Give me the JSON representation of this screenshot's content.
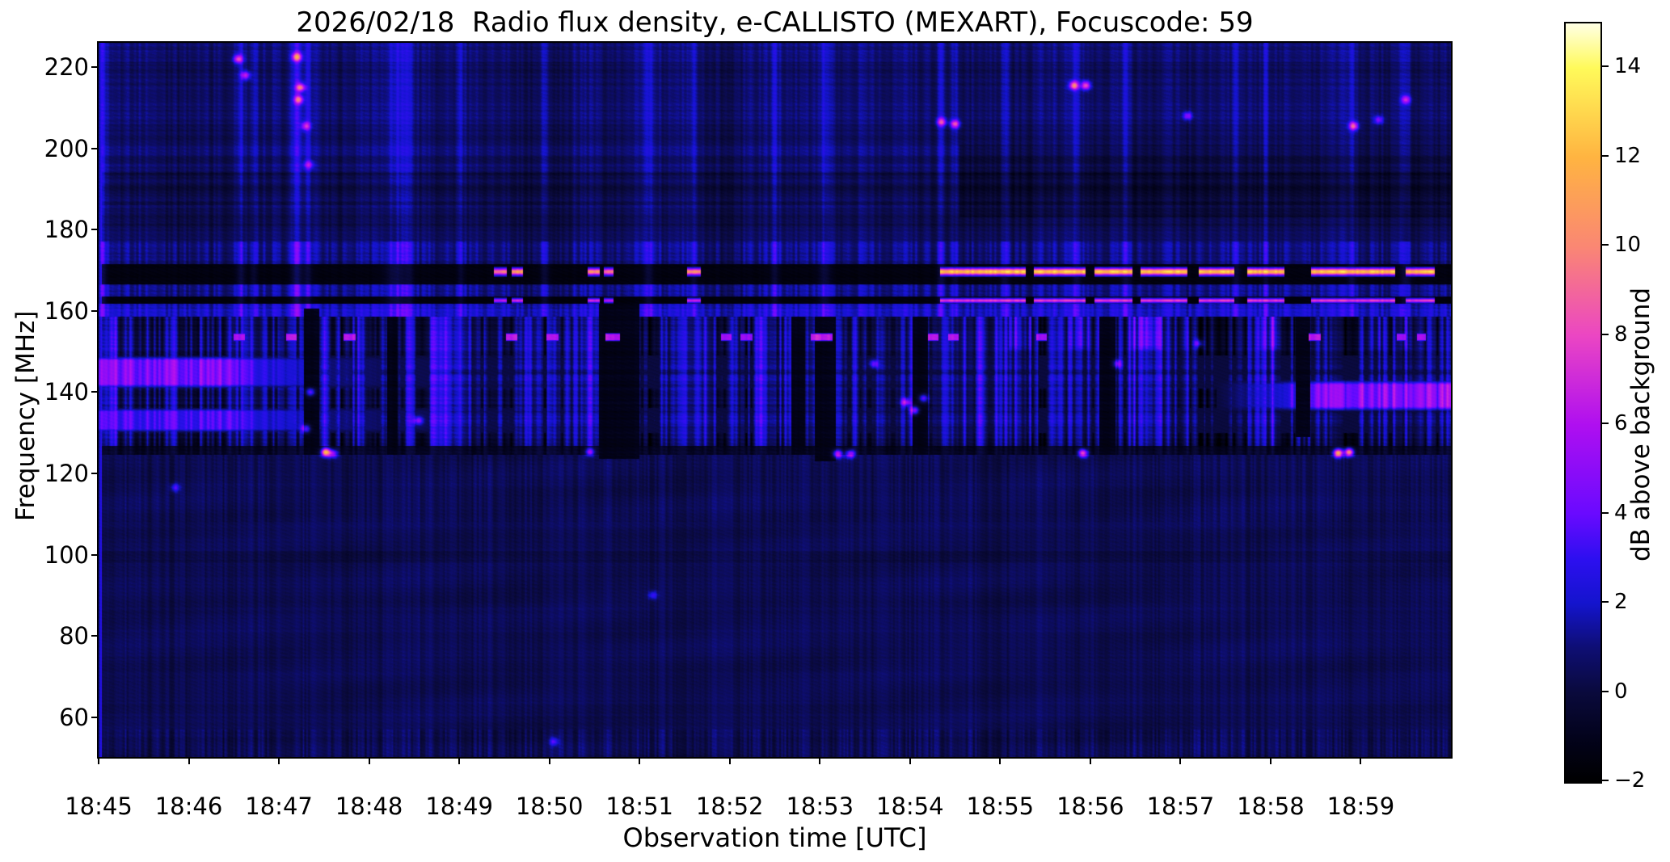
{
  "chart_data": {
    "type": "heatmap",
    "subtype": "radio-spectrogram",
    "title": "2026/02/18  Radio flux density, e-CALLISTO (MEXART), Focuscode: 59",
    "xlabel": "Observation time [UTC]",
    "ylabel": "Frequency [MHz]",
    "colorbar_label": "dB above background",
    "x_tick_labels": [
      "18:45",
      "18:46",
      "18:47",
      "18:48",
      "18:49",
      "18:50",
      "18:51",
      "18:52",
      "18:53",
      "18:54",
      "18:55",
      "18:56",
      "18:57",
      "18:58",
      "18:59"
    ],
    "x_tick_minutes": [
      0,
      1,
      2,
      3,
      4,
      5,
      6,
      7,
      8,
      9,
      10,
      11,
      12,
      13,
      14
    ],
    "time_range_minutes": [
      0,
      15
    ],
    "time_start_label": "18:45",
    "y_tick_values": [
      220,
      200,
      180,
      160,
      140,
      120,
      100,
      80,
      60
    ],
    "freq_range_mhz": [
      50.2,
      226
    ],
    "colorbar_tick_values": [
      -2,
      0,
      2,
      4,
      6,
      8,
      10,
      12,
      14
    ],
    "colorbar_tick_labels": [
      "−2",
      "0",
      "2",
      "4",
      "6",
      "8",
      "10",
      "12",
      "14"
    ],
    "value_range_db": [
      -2,
      15
    ],
    "colormap_stops": [
      {
        "v": -2,
        "c": [
          0,
          0,
          0
        ]
      },
      {
        "v": -1,
        "c": [
          3,
          3,
          28
        ]
      },
      {
        "v": 0,
        "c": [
          10,
          10,
          60
        ]
      },
      {
        "v": 1,
        "c": [
          14,
          14,
          115
        ]
      },
      {
        "v": 2,
        "c": [
          20,
          20,
          205
        ]
      },
      {
        "v": 3,
        "c": [
          45,
          15,
          240
        ]
      },
      {
        "v": 4,
        "c": [
          105,
          10,
          255
        ]
      },
      {
        "v": 6,
        "c": [
          175,
          15,
          240
        ]
      },
      {
        "v": 8,
        "c": [
          235,
          70,
          195
        ]
      },
      {
        "v": 10,
        "c": [
          250,
          135,
          115
        ]
      },
      {
        "v": 12,
        "c": [
          255,
          180,
          65
        ]
      },
      {
        "v": 14,
        "c": [
          255,
          250,
          90
        ]
      },
      {
        "v": 15,
        "c": [
          255,
          255,
          228
        ]
      }
    ],
    "spectral_regions": [
      {
        "name": "low-quiet",
        "f": [
          50.2,
          124.5
        ],
        "base_db": 0.42,
        "stripe_db": 0.42,
        "note": "uniform dark blue, fine vertical striping, stronger stripes below 57 MHz"
      },
      {
        "name": "active-mixed",
        "f": [
          124.5,
          158.5
        ],
        "base_db": 1.05,
        "stripe_db": 2.1,
        "note": "alternating blue and black vertical columns"
      },
      {
        "name": "bright-noise",
        "f": [
          158.5,
          161.8
        ],
        "base_db": 2.0,
        "stripe_db": 0.9
      },
      {
        "name": "black-line-162",
        "f": [
          161.8,
          163.5
        ],
        "base_db": -1.45
      },
      {
        "name": "noise-164",
        "f": [
          163.5,
          166.5
        ],
        "base_db": 1.3,
        "stripe_db": 0.9
      },
      {
        "name": "black-band-169",
        "f": [
          166.5,
          171.5
        ],
        "base_db": -1.5
      },
      {
        "name": "noise-174",
        "f": [
          171.5,
          177
        ],
        "base_db": 1.0,
        "stripe_db": 0.9
      },
      {
        "name": "high-band",
        "f": [
          177,
          226
        ],
        "base_db": 0.72,
        "stripe_db": 0.55,
        "dark_rows": [
          [
            186,
            194,
            -0.5
          ],
          [
            180.5,
            184,
            -0.35
          ],
          [
            202,
            204.5,
            -0.2
          ]
        ],
        "right_dark_swath": {
          "t_after": 9.55,
          "f": [
            183,
            201
          ],
          "db": -0.55
        }
      }
    ],
    "channel_lines": [
      {
        "name": "bright-carrier-170MHz",
        "f_center": 169.65,
        "f_width": 1.5,
        "peak_db": 13.8,
        "segments": [
          [
            4.38,
            4.53,
            10.5
          ],
          [
            4.58,
            4.71,
            12.5
          ],
          [
            5.42,
            5.56,
            11
          ],
          [
            5.6,
            5.71,
            10.5
          ],
          [
            6.53,
            6.68,
            11.5
          ],
          [
            9.33,
            15,
            13.8
          ]
        ],
        "gaps": [
          [
            10.28,
            10.37
          ],
          [
            10.95,
            11.05
          ],
          [
            11.47,
            11.56
          ],
          [
            12.08,
            12.2
          ],
          [
            12.6,
            12.74
          ],
          [
            13.15,
            13.45
          ],
          [
            14.38,
            14.5
          ],
          [
            14.82,
            15
          ]
        ]
      },
      {
        "name": "carrier-162.5MHz",
        "f_center": 162.55,
        "f_width": 0.95,
        "peak_db": 8.6,
        "segments": [
          [
            4.38,
            4.53,
            7
          ],
          [
            4.58,
            4.71,
            8
          ],
          [
            5.42,
            5.56,
            7.5
          ],
          [
            5.6,
            5.71,
            7
          ],
          [
            6.53,
            6.68,
            7.5
          ],
          [
            9.33,
            15,
            8.6
          ]
        ],
        "gaps": [
          [
            10.28,
            10.37
          ],
          [
            10.95,
            11.05
          ],
          [
            11.47,
            11.56
          ],
          [
            12.08,
            12.2
          ],
          [
            12.6,
            12.74
          ],
          [
            13.15,
            13.45
          ],
          [
            14.38,
            14.5
          ],
          [
            14.82,
            15
          ]
        ]
      }
    ],
    "dash_line_153": {
      "f": [
        152.9,
        154.2
      ],
      "segments": [
        [
          1.5,
          1.62,
          6.5
        ],
        [
          2.08,
          2.2,
          7
        ],
        [
          2.72,
          2.85,
          7
        ],
        [
          4.52,
          4.64,
          7.5
        ],
        [
          4.97,
          5.1,
          6.5
        ],
        [
          5.62,
          5.78,
          7
        ],
        [
          6.9,
          7.02,
          6.5
        ],
        [
          7.12,
          7.25,
          6
        ],
        [
          7.9,
          8.02,
          7.5
        ],
        [
          8.02,
          8.14,
          7
        ],
        [
          9.2,
          9.32,
          7.5
        ],
        [
          9.42,
          9.54,
          7
        ],
        [
          10.4,
          10.52,
          6.5
        ],
        [
          13.42,
          13.56,
          7
        ],
        [
          14.4,
          14.5,
          6.5
        ],
        [
          14.62,
          14.72,
          6.5
        ]
      ]
    },
    "bright_patches": [
      {
        "name": "left-145MHz-band",
        "t": [
          0,
          1.35
        ],
        "fade_minutes": 0.9,
        "f": [
          142,
          147.8
        ],
        "peak_db": 6.5
      },
      {
        "name": "left-133MHz-band",
        "t": [
          0,
          1.45
        ],
        "fade_minutes": 1.1,
        "f": [
          131,
          135.2
        ],
        "peak_db": 4.8
      },
      {
        "name": "right-139MHz-band",
        "t": [
          12.4,
          15
        ],
        "ramp_minutes": 1.3,
        "f": [
          136.5,
          141.8
        ],
        "peak_db": 7.2
      },
      {
        "name": "right-154MHz-patches",
        "t": [
          10.1,
          15
        ],
        "f": [
          151.5,
          158.3
        ],
        "peak_db": 3.2
      }
    ],
    "black_columns": [
      [
        2.28,
        2.45,
        124.5,
        160.5
      ],
      [
        3.2,
        3.32,
        124.5,
        158.5
      ],
      [
        5.55,
        6.0,
        123.5,
        161.8
      ],
      [
        7.68,
        7.84,
        124.5,
        158.5
      ],
      [
        7.94,
        8.18,
        123,
        158.5
      ],
      [
        9.03,
        9.2,
        124.5,
        158.5
      ],
      [
        11.1,
        11.28,
        124.5,
        158.5
      ],
      [
        13.28,
        13.44,
        129,
        158.5
      ]
    ],
    "streak_columns": [
      [
        0.05,
        0.04,
        1.8
      ],
      [
        1.58,
        0.05,
        1.6
      ],
      [
        1.72,
        0.04,
        1.2
      ],
      [
        2.2,
        0.06,
        2.2
      ],
      [
        2.32,
        0.05,
        1.5
      ],
      [
        3.3,
        0.12,
        1.8
      ],
      [
        3.45,
        0.05,
        1.0
      ],
      [
        4.02,
        0.04,
        1.1
      ],
      [
        4.95,
        0.05,
        1.4
      ],
      [
        6.1,
        0.05,
        1.5
      ],
      [
        6.6,
        0.04,
        1.2
      ],
      [
        7.5,
        0.05,
        1.3
      ],
      [
        8.05,
        0.07,
        1.5
      ],
      [
        9.35,
        0.05,
        1.6
      ],
      [
        9.5,
        0.04,
        1.2
      ],
      [
        10.05,
        0.05,
        1.3
      ],
      [
        10.85,
        0.05,
        1.5
      ],
      [
        11.4,
        0.06,
        1.4
      ],
      [
        12.62,
        0.05,
        1.3
      ],
      [
        12.95,
        0.04,
        1.1
      ],
      [
        13.9,
        0.05,
        1.5
      ],
      [
        14.5,
        0.06,
        1.6
      ]
    ],
    "transient_events": [
      [
        1.55,
        222,
        6.5
      ],
      [
        1.63,
        218,
        5.5
      ],
      [
        2.2,
        222.5,
        8.5
      ],
      [
        2.24,
        215,
        7.5
      ],
      [
        2.22,
        212,
        7
      ],
      [
        2.3,
        205.5,
        5.5
      ],
      [
        2.33,
        196,
        4
      ],
      [
        9.35,
        206.5,
        6.5
      ],
      [
        9.5,
        206,
        7
      ],
      [
        10.82,
        215.5,
        8.5
      ],
      [
        10.95,
        215.5,
        7.5
      ],
      [
        12.08,
        208,
        4.5
      ],
      [
        13.92,
        205.5,
        7.5
      ],
      [
        14.5,
        212,
        5.5
      ],
      [
        14.2,
        207,
        4
      ],
      [
        2.52,
        125.2,
        12
      ],
      [
        2.6,
        124.9,
        6
      ],
      [
        5.45,
        125.3,
        5.5
      ],
      [
        8.2,
        124.8,
        7
      ],
      [
        8.34,
        124.8,
        6.5
      ],
      [
        10.92,
        125,
        9
      ],
      [
        13.75,
        125,
        12
      ],
      [
        13.87,
        125.2,
        11
      ],
      [
        8.95,
        137.5,
        5.5
      ],
      [
        9.05,
        135.5,
        6
      ],
      [
        9.15,
        138.5,
        5
      ],
      [
        8.6,
        147,
        4
      ],
      [
        11.3,
        147,
        4.2
      ],
      [
        12.2,
        152,
        4
      ],
      [
        3.55,
        133,
        4.5
      ],
      [
        2.35,
        140,
        5
      ],
      [
        2.3,
        131,
        5
      ],
      [
        0.85,
        116.5,
        3.2
      ],
      [
        6.15,
        90,
        3
      ],
      [
        5.05,
        54,
        3.2
      ]
    ],
    "low_band_dark_rows": [
      [
        98,
        101,
        -0.28
      ],
      [
        88,
        90.5,
        -0.15
      ]
    ]
  }
}
